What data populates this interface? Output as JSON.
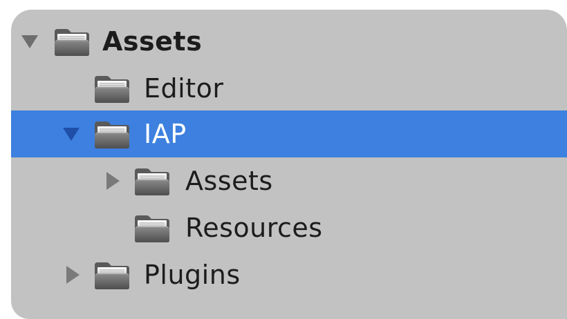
{
  "tree": {
    "root": {
      "label": "Assets",
      "icon": "folder-icon",
      "expanded": true
    },
    "editor": {
      "label": "Editor",
      "icon": "folder-icon"
    },
    "iap": {
      "label": "IAP",
      "icon": "folder-icon",
      "expanded": true,
      "selected": true
    },
    "iap_assets": {
      "label": "Assets",
      "icon": "folder-icon",
      "expanded": false
    },
    "iap_resources": {
      "label": "Resources",
      "icon": "folder-icon"
    },
    "plugins": {
      "label": "Plugins",
      "icon": "folder-icon",
      "expanded": false
    }
  },
  "colors": {
    "panel_bg": "#c2c2c2",
    "selection": "#3d80df",
    "text": "#1c1c1c",
    "selected_text": "#ffffff"
  }
}
